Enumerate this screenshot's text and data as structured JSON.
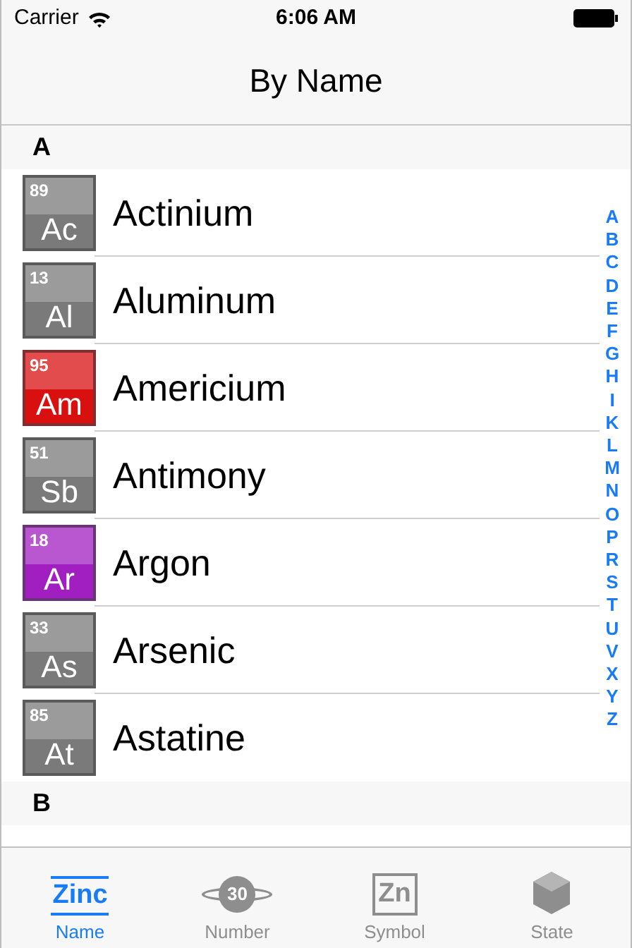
{
  "status_bar": {
    "carrier": "Carrier",
    "time": "6:06 AM"
  },
  "nav_bar": {
    "title": "By Name"
  },
  "sections": [
    {
      "header": "A",
      "rows": [
        {
          "number": "89",
          "symbol": "Ac",
          "name": "Actinium",
          "color": "#7a7a7a"
        },
        {
          "number": "13",
          "symbol": "Al",
          "name": "Aluminum",
          "color": "#7a7a7a"
        },
        {
          "number": "95",
          "symbol": "Am",
          "name": "Americium",
          "color": "#d81010"
        },
        {
          "number": "51",
          "symbol": "Sb",
          "name": "Antimony",
          "color": "#7a7a7a"
        },
        {
          "number": "18",
          "symbol": "Ar",
          "name": "Argon",
          "color": "#a11fc0"
        },
        {
          "number": "33",
          "symbol": "As",
          "name": "Arsenic",
          "color": "#7a7a7a"
        },
        {
          "number": "85",
          "symbol": "At",
          "name": "Astatine",
          "color": "#7a7a7a"
        }
      ]
    },
    {
      "header": "B"
    }
  ],
  "index": [
    "A",
    "B",
    "C",
    "D",
    "E",
    "F",
    "G",
    "H",
    "I",
    "K",
    "L",
    "M",
    "N",
    "O",
    "P",
    "R",
    "S",
    "T",
    "U",
    "V",
    "X",
    "Y",
    "Z"
  ],
  "tabs": [
    {
      "kind": "word",
      "icon_text": "Zinc",
      "label": "Name",
      "selected": true
    },
    {
      "kind": "orbit",
      "icon_text": "30",
      "label": "Number",
      "selected": false
    },
    {
      "kind": "box",
      "icon_text": "Zn",
      "label": "Symbol",
      "selected": false
    },
    {
      "kind": "cube",
      "label": "State",
      "selected": false
    }
  ]
}
